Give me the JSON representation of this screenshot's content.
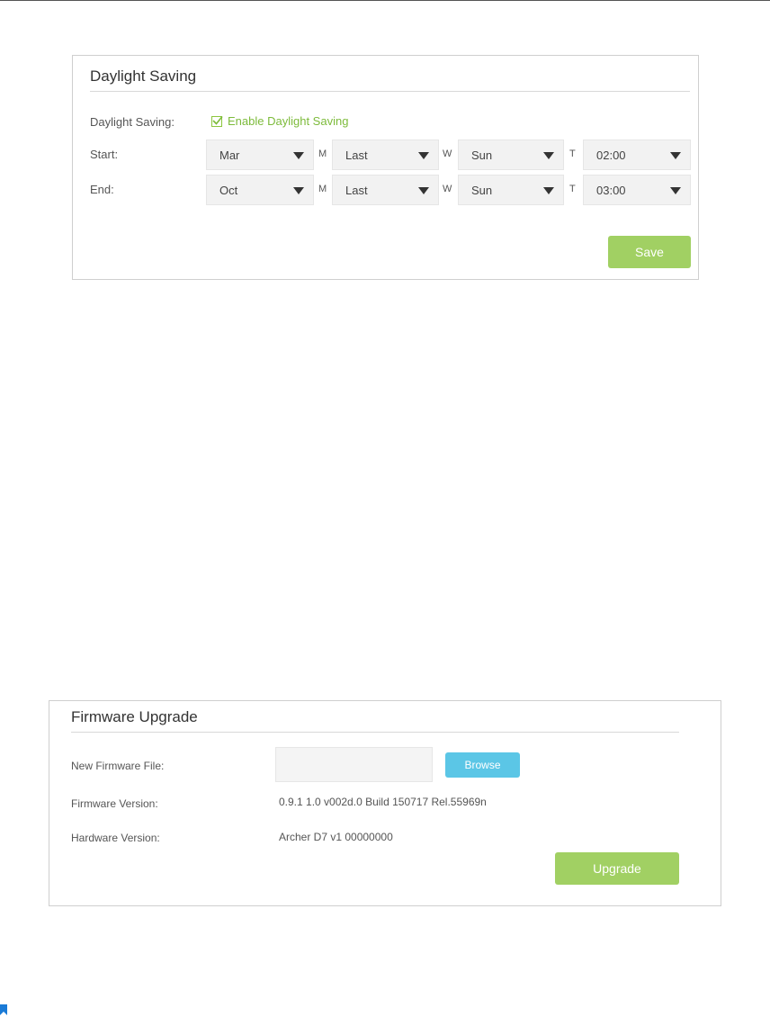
{
  "daylight_saving": {
    "title": "Daylight Saving",
    "label": "Daylight Saving:",
    "checkbox_label": "Enable Daylight Saving",
    "checked": true,
    "start_label": "Start:",
    "end_label": "End:",
    "sep_month": "M",
    "sep_week": "W",
    "sep_time": "T",
    "start": {
      "month": "Mar",
      "week": "Last",
      "day": "Sun",
      "time": "02:00"
    },
    "end": {
      "month": "Oct",
      "week": "Last",
      "day": "Sun",
      "time": "03:00"
    },
    "save_label": "Save"
  },
  "firmware_upgrade": {
    "title": "Firmware Upgrade",
    "new_file_label": "New Firmware File:",
    "file_value": "",
    "browse_label": "Browse",
    "firmware_version_label": "Firmware Version:",
    "firmware_version": "0.9.1 1.0 v002d.0 Build 150717 Rel.55969n",
    "hardware_version_label": "Hardware Version:",
    "hardware_version": "Archer D7 v1 00000000",
    "upgrade_label": "Upgrade"
  },
  "colors": {
    "accent_green": "#a1d063",
    "checkbox_green": "#7dbb3b",
    "browse_blue": "#5bc6e6"
  },
  "icons": [
    "check-icon",
    "chevron-down-icon",
    "bookmark-icon"
  ]
}
